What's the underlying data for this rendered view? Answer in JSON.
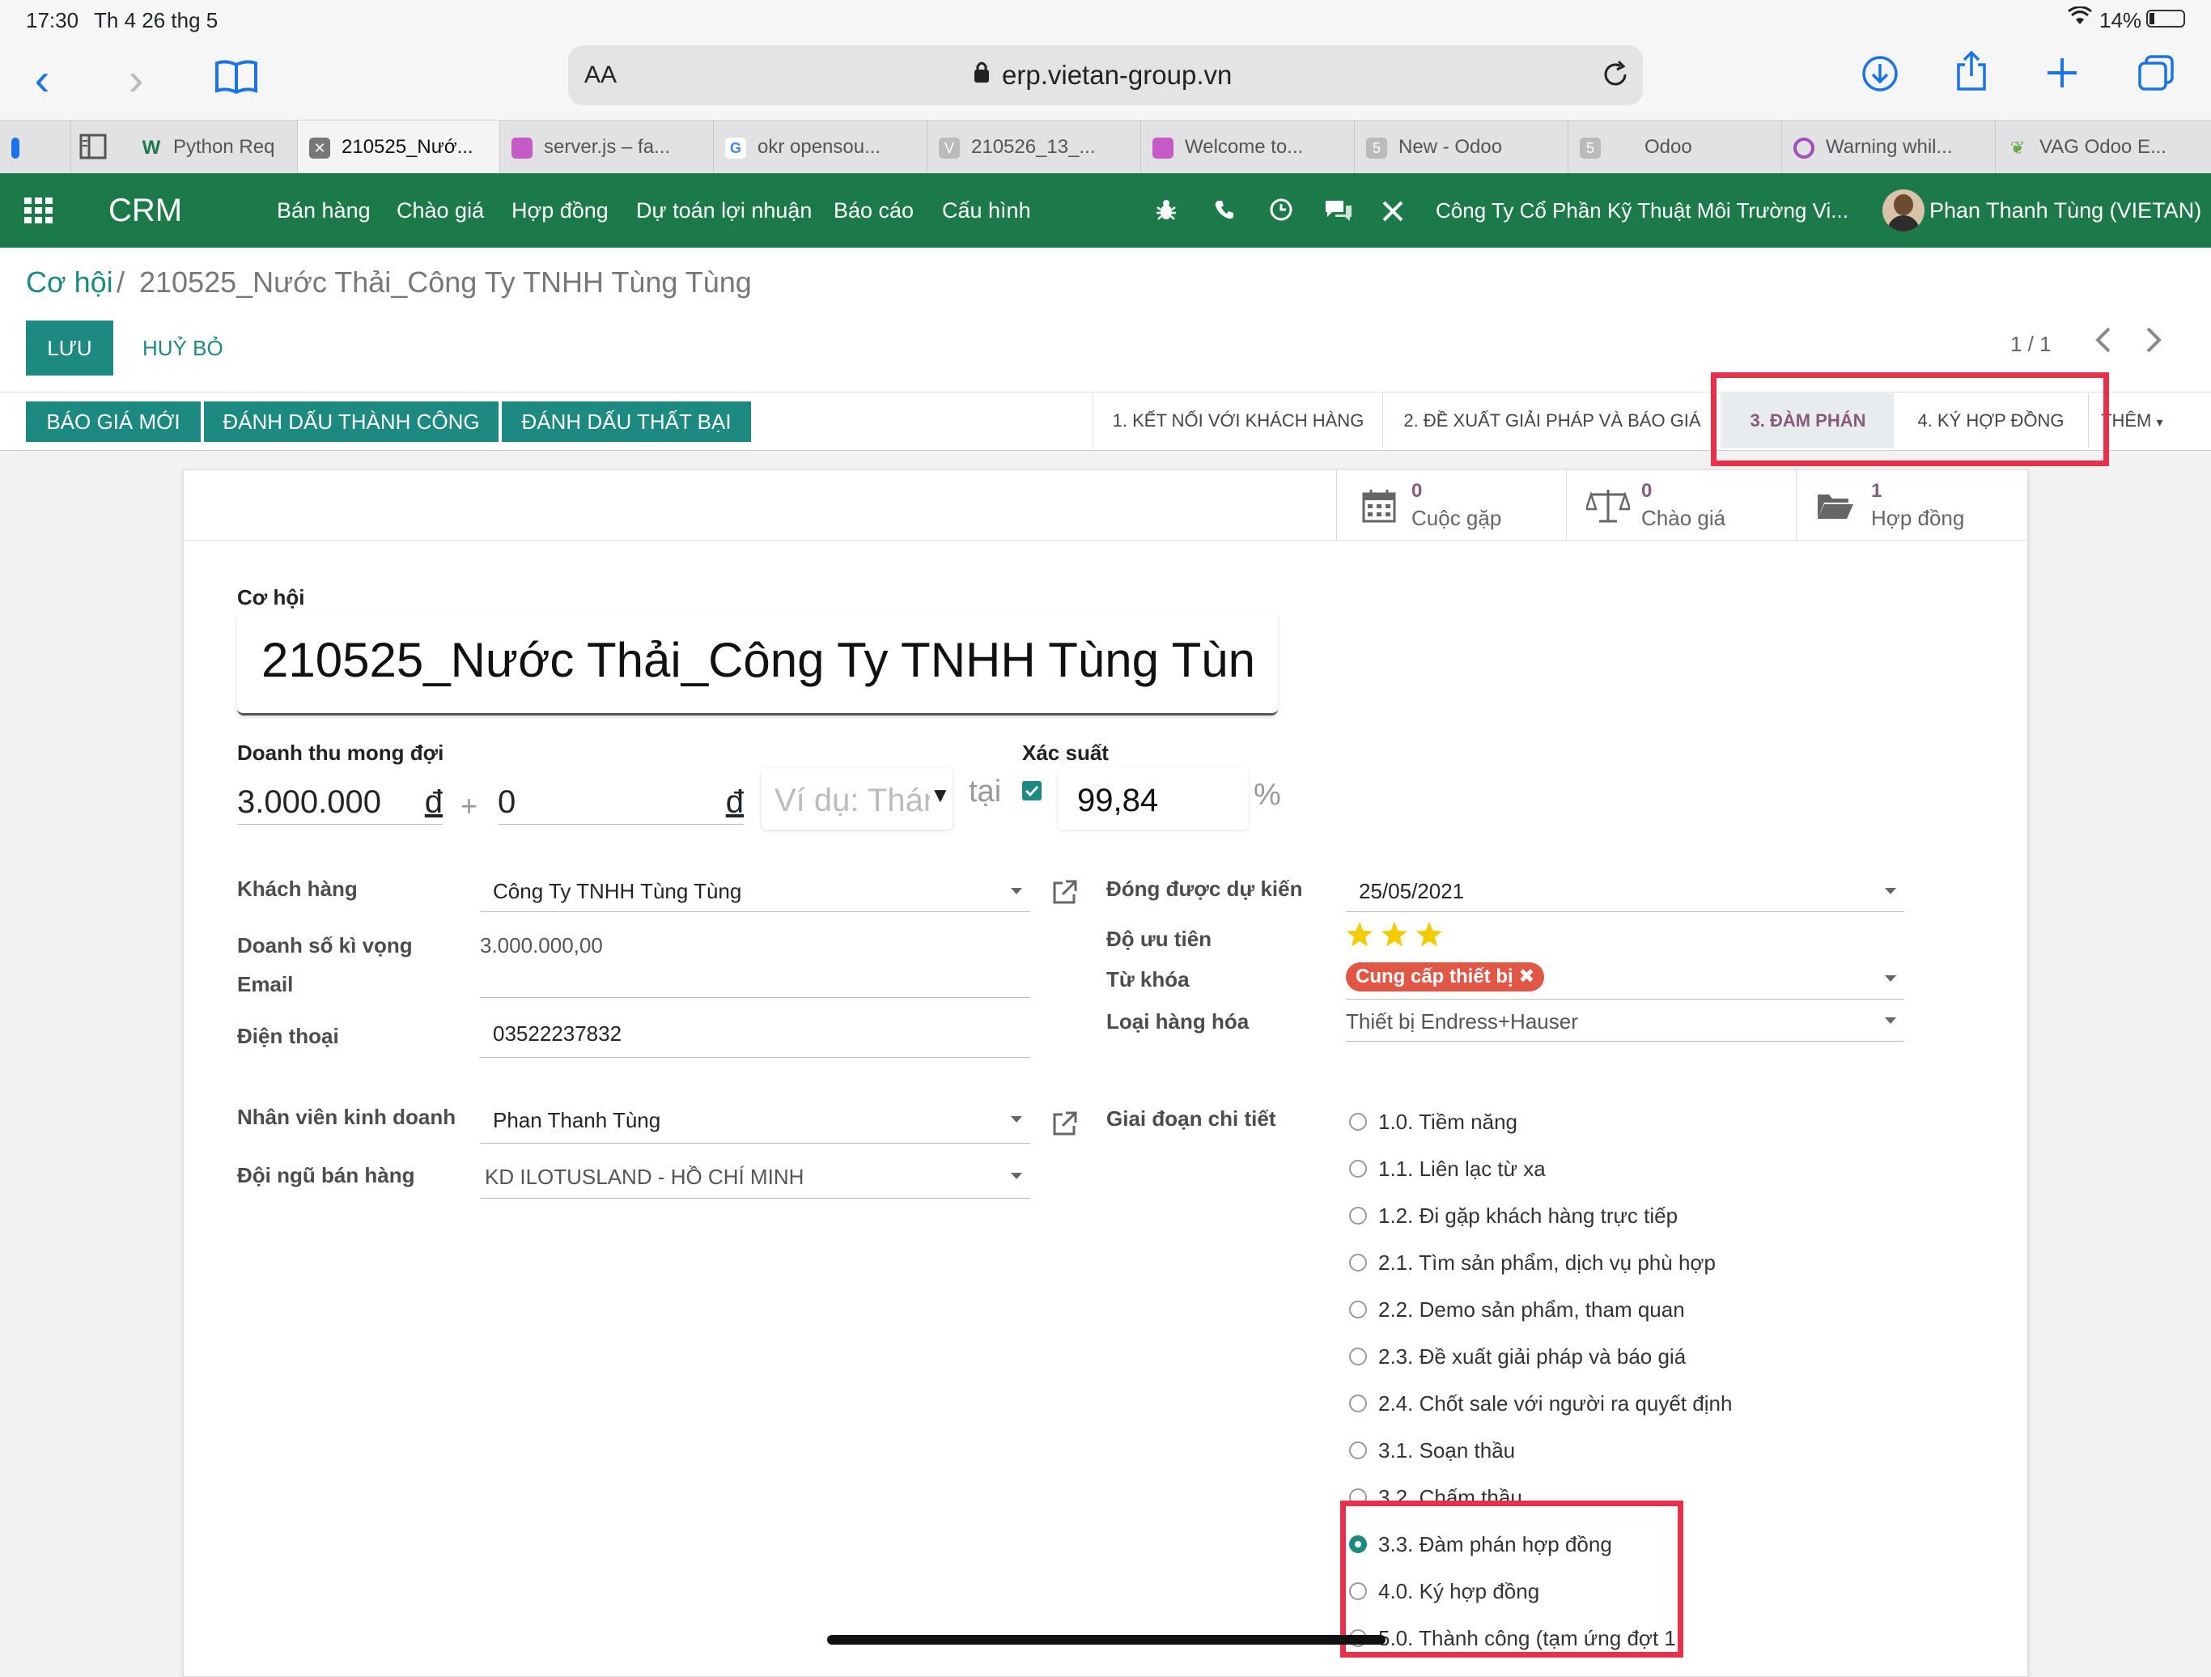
{
  "status_bar": {
    "time": "17:30",
    "date": "Th 4 26 thg 5",
    "battery": "14%"
  },
  "browser": {
    "url": "erp.vietan-group.vn",
    "aa_label": "AA",
    "tabs": [
      {
        "label": "Python Req",
        "icon": "w-icon"
      },
      {
        "label": "210525_Nướ...",
        "icon": "close-icon",
        "active": true
      },
      {
        "label": "server.js – fa...",
        "icon": "site-icon"
      },
      {
        "label": "okr opensou...",
        "icon": "google-icon"
      },
      {
        "label": "210526_13_...",
        "icon": "v-icon"
      },
      {
        "label": "Welcome to...",
        "icon": "site-icon"
      },
      {
        "label": "New - Odoo",
        "icon": "5-icon"
      },
      {
        "label": "Odoo",
        "icon": "5-icon"
      },
      {
        "label": "Warning whil...",
        "icon": "circle-icon"
      },
      {
        "label": "VAG Odoo E...",
        "icon": "leaf-icon"
      }
    ]
  },
  "app": {
    "name": "CRM",
    "menu": [
      "Bán hàng",
      "Chào giá",
      "Hợp đồng",
      "Dự toán lợi nhuận",
      "Báo cáo",
      "Cấu hình"
    ],
    "company": "Công Ty Cổ Phần Kỹ Thuật Môi Trường Vi...",
    "user": "Phan Thanh Tùng (VIETAN)",
    "brand_color": "#1c7a4a"
  },
  "breadcrumb": {
    "parent": "Cơ hội",
    "separator": "/",
    "current": "210525_Nước Thải_Công Ty TNHH Tùng Tùng"
  },
  "actions": {
    "save": "LƯU",
    "discard": "HUỶ BỎ",
    "pager": "1 / 1"
  },
  "header_buttons": [
    "BÁO GIÁ MỚI",
    "ĐÁNH DẤU THÀNH CÔNG",
    "ĐÁNH DẤU THẤT BẠI"
  ],
  "stages": [
    "1. KẾT NỐI VỚI KHÁCH HÀNG",
    "2. ĐỀ XUẤT GIẢI PHÁP VÀ BÁO GIÁ",
    "3. ĐÀM PHÁN",
    "4. KÝ HỢP ĐỒNG"
  ],
  "stages_more": "THÊM",
  "smart_buttons": [
    {
      "count": "0",
      "label": "Cuộc gặp",
      "icon": "calendar-icon"
    },
    {
      "count": "0",
      "label": "Chào giá",
      "icon": "scale-icon"
    },
    {
      "count": "1",
      "label": "Hợp đồng",
      "icon": "folder-icon"
    }
  ],
  "form": {
    "title_label": "Cơ hội",
    "title_value": "210525_Nước Thải_Công Ty TNHH Tùng Tùn",
    "revenue_label": "Doanh thu mong đợi",
    "revenue_value": "3.000.000",
    "currency": "đ",
    "plus": "+",
    "extra_value": "0",
    "recurring_placeholder": "Ví dụ: Thár",
    "at_label": "tại",
    "probability_label": "Xác suất",
    "probability_value": "99,84",
    "percent": "%",
    "customer_label": "Khách hàng",
    "customer_value": "Công Ty TNHH Tùng Tùng",
    "expected_sales_label": "Doanh số kì vọng",
    "expected_sales_value": "3.000.000,00",
    "email_label": "Email",
    "email_value": "",
    "phone_label": "Điện thoại",
    "phone_value": "03522237832",
    "salesperson_label": "Nhân viên kinh doanh",
    "salesperson_value": "Phan Thanh Tùng",
    "team_label": "Đội ngũ bán hàng",
    "team_value": "KD ILOTUSLAND - HỒ CHÍ MINH",
    "close_date_label": "Đóng được dự kiến",
    "close_date_value": "25/05/2021",
    "priority_label": "Độ ưu tiên",
    "priority_stars": 3,
    "tags_label": "Từ khóa",
    "tag_value": "Cung cấp thiết bị",
    "goods_label": "Loại hàng hóa",
    "goods_value": "Thiết bị Endress+Hauser",
    "stage_detail_label": "Giai đoạn chi tiết",
    "stage_options": [
      "1.0. Tiềm năng",
      "1.1. Liên lạc từ xa",
      "1.2. Đi gặp khách hàng trực tiếp",
      "2.1. Tìm sản phẩm, dịch vụ phù hợp",
      "2.2. Demo sản phẩm, tham quan",
      "2.3. Đề xuất giải pháp và báo giá",
      "2.4. Chốt sale với người ra quyết định",
      "3.1. Soạn thầu",
      "3.2. Chấm thầu",
      "3.3. Đàm phán hợp đồng",
      "4.0. Ký hợp đồng",
      "5.0. Thành công (tạm ứng đợt 1"
    ],
    "stage_selected_index": 9
  },
  "colors": {
    "primary": "#1c8a80",
    "highlight": "#e8304a",
    "tag": "#e25645",
    "link": "#1c8a80"
  }
}
